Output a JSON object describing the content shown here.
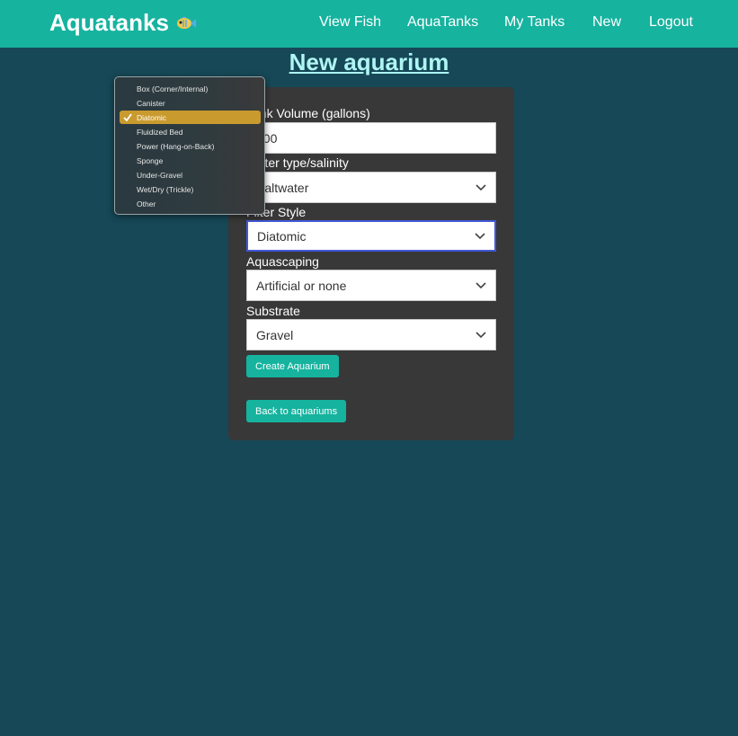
{
  "nav": {
    "brand": "Aquatanks",
    "brand_icon": "fish-icon",
    "links": [
      "View Fish",
      "AquaTanks",
      "My Tanks",
      "New",
      "Logout"
    ]
  },
  "page": {
    "title": "New aquarium"
  },
  "form": {
    "volume_label": "Tank Volume (gallons)",
    "volume_value": "100",
    "water_label": "Water type/salinity",
    "water_value": "Saltwater",
    "filter_label": "Filter Style",
    "filter_value": "Diatomic",
    "aquascaping_label": "Aquascaping",
    "aquascaping_value": "Artificial or none",
    "substrate_label": "Substrate",
    "substrate_value": "Gravel",
    "create_button": "Create Aquarium",
    "back_button": "Back to aquariums"
  },
  "filter_dropdown": {
    "options": [
      "Box (Corner/Internal)",
      "Canister",
      "Diatomic",
      "Fluidized Bed",
      "Power (Hang-on-Back)",
      "Sponge",
      "Under-Gravel",
      "Wet/Dry (Trickle)",
      "Other"
    ],
    "selected": "Diatomic"
  },
  "colors": {
    "navbar": "#16b39f",
    "background": "#164857",
    "card": "#383838",
    "accent": "#16b39f",
    "selected_option": "#c99a2e",
    "focus_border": "#4258d6"
  }
}
